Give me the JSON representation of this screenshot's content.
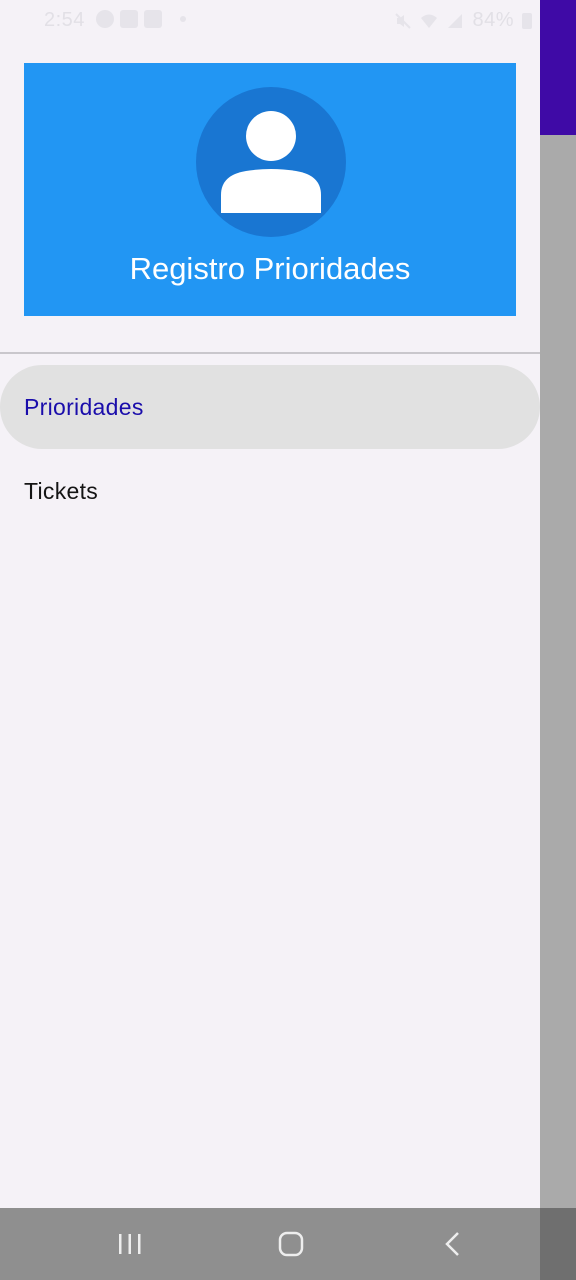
{
  "status_bar": {
    "time": "2:54",
    "battery": "84%",
    "icons_left": [
      "messenger-icon",
      "gallery-icon",
      "mail-icon",
      "notification-dot"
    ],
    "icons_right": [
      "mute-icon",
      "wifi-icon",
      "signal-icon",
      "battery-icon"
    ]
  },
  "drawer": {
    "header": {
      "title": "Registro Prioridades",
      "avatar_icon": "person-icon",
      "background_color": "#2296f3",
      "avatar_color": "#1976d2"
    },
    "items": [
      {
        "label": "Prioridades",
        "active": true,
        "text_color": "#1a0dab"
      },
      {
        "label": "Tickets",
        "active": false,
        "text_color": "#151515"
      }
    ]
  },
  "background_app": {
    "toolbar_color": "#3f0aa6"
  },
  "nav_bar": {
    "buttons": [
      "recents-icon",
      "home-icon",
      "back-icon"
    ]
  }
}
